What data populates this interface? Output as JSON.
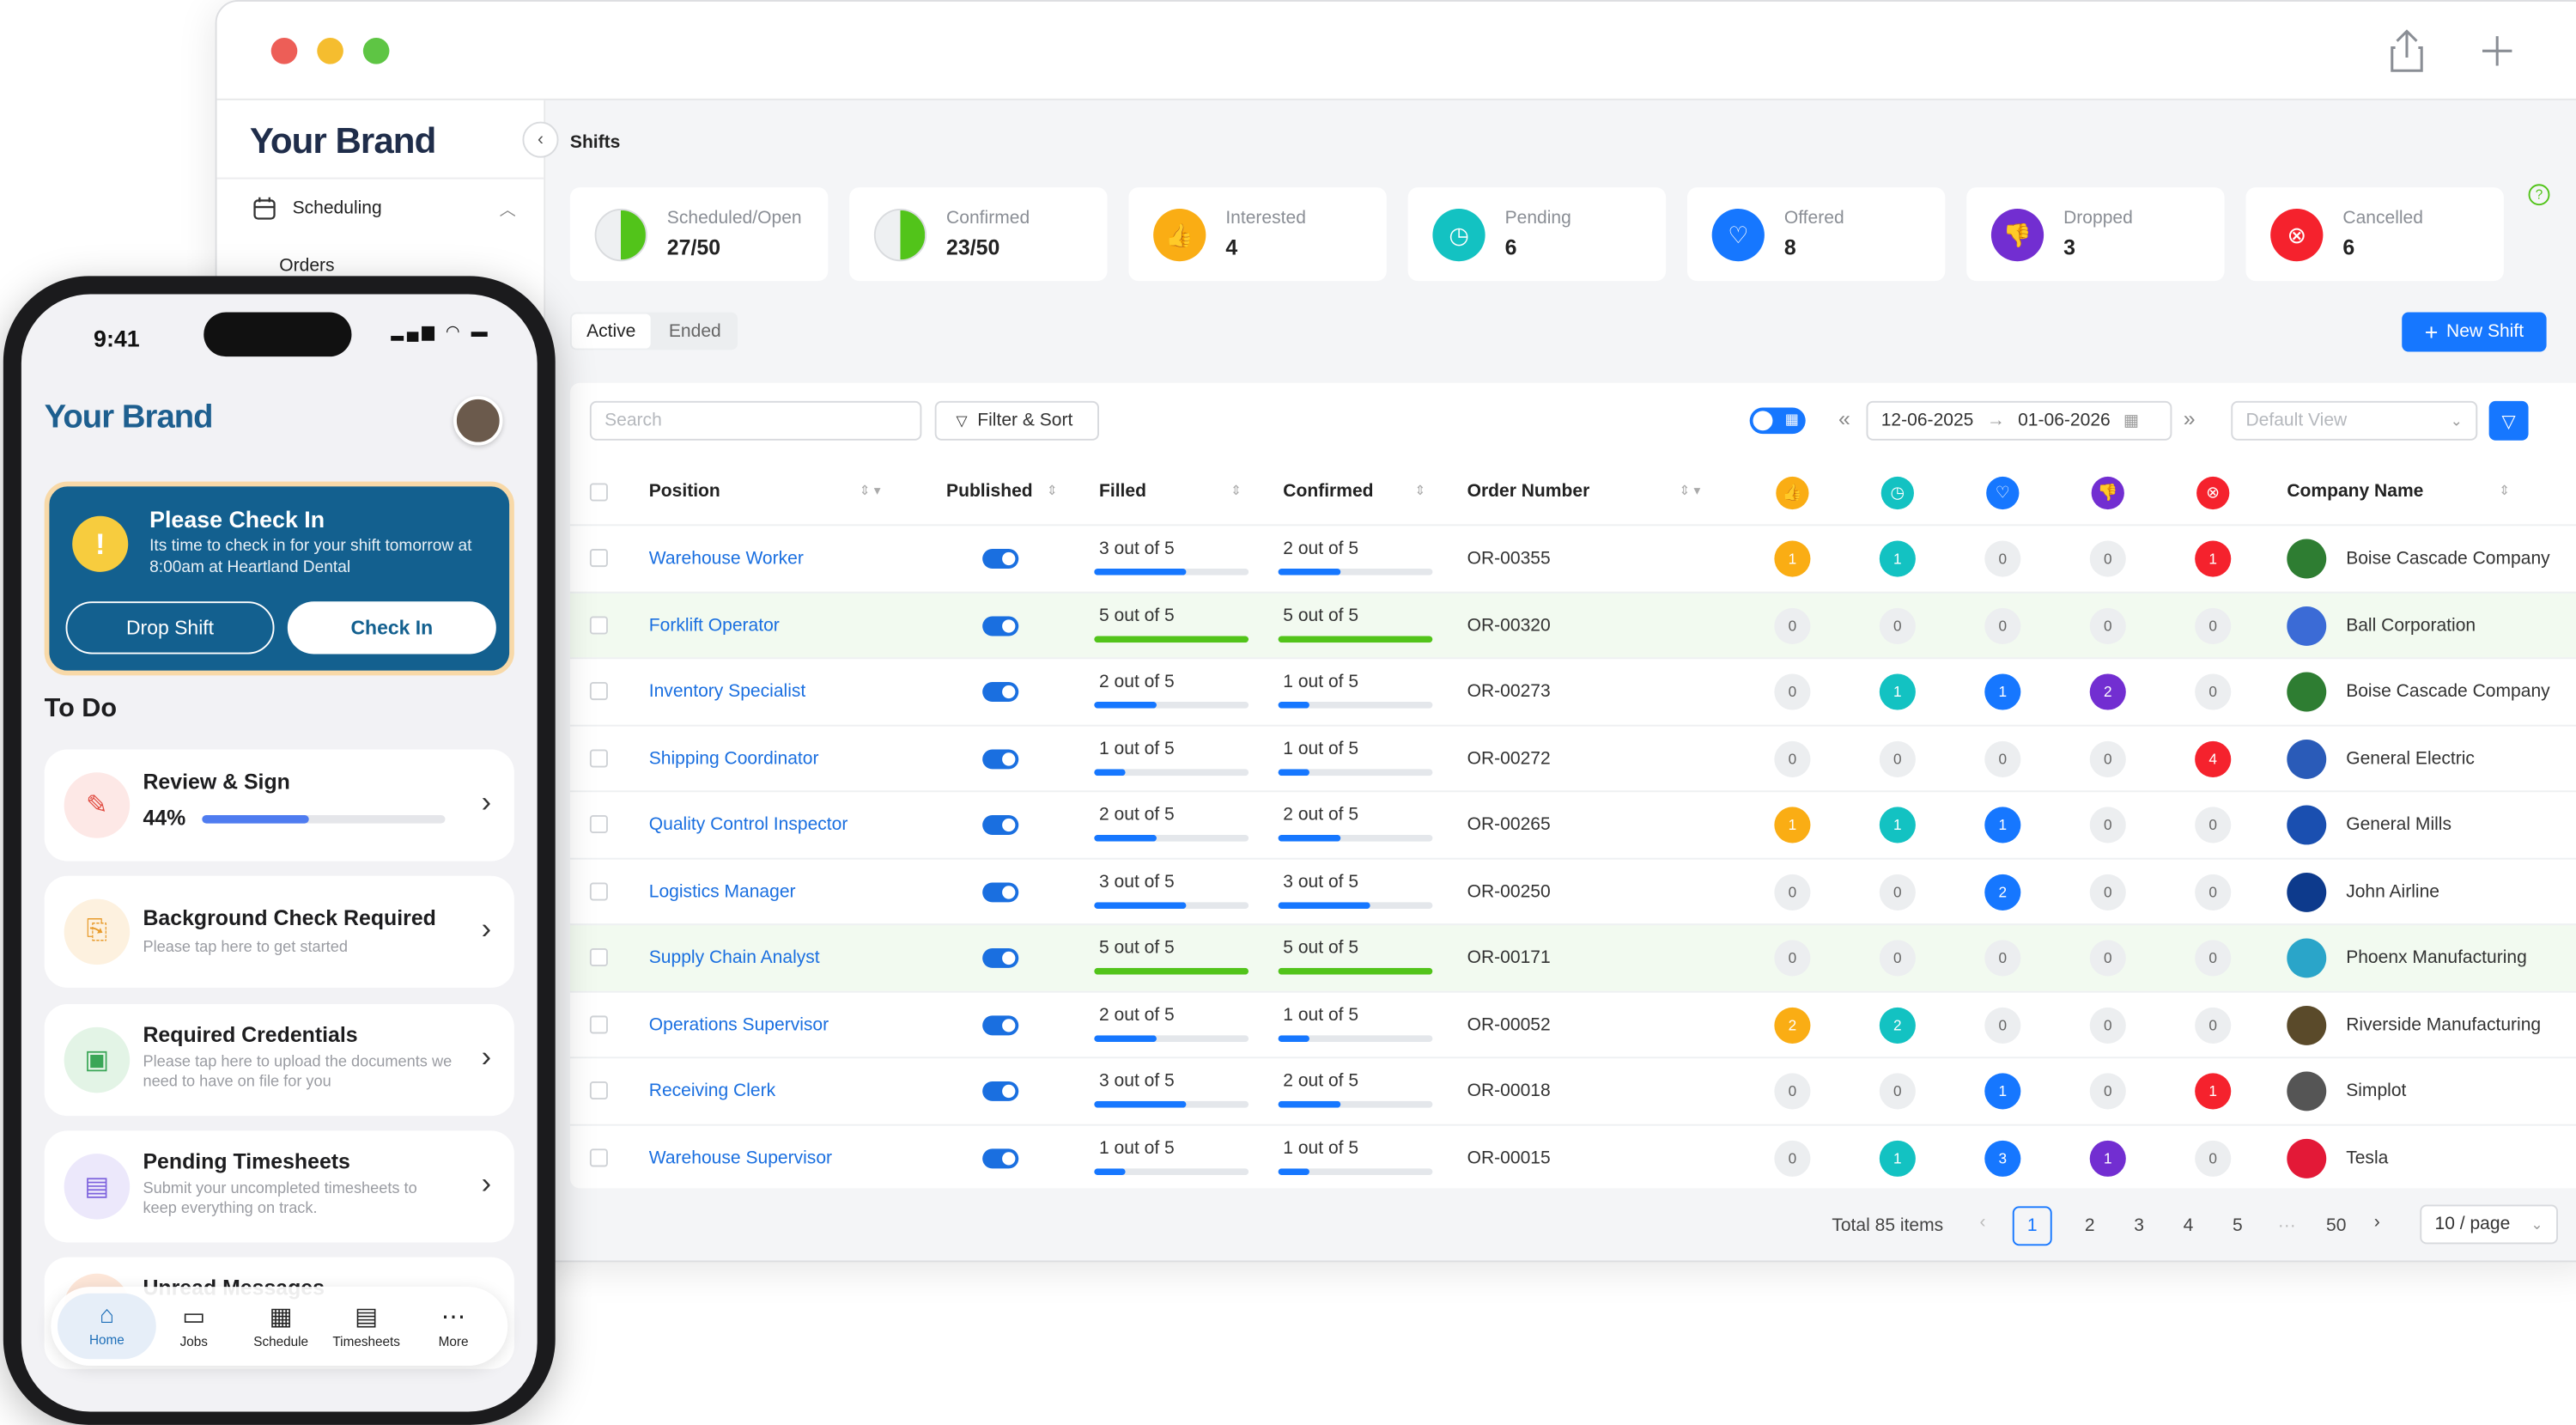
{
  "window": {
    "share_icon": "share-icon",
    "plus_icon": "plus-icon"
  },
  "sidebar": {
    "brand": "Your Brand",
    "items": [
      {
        "label": "Scheduling",
        "icon": "calendar-icon"
      },
      {
        "label": "Orders"
      }
    ]
  },
  "header": {
    "title": "Shifts"
  },
  "stats": [
    {
      "label": "Scheduled/Open",
      "value": "27/50",
      "icon": "half-pie-icon",
      "color": "#52c41a"
    },
    {
      "label": "Confirmed",
      "value": "23/50",
      "icon": "half-pie-icon",
      "color": "#52c41a"
    },
    {
      "label": "Interested",
      "value": "4",
      "icon": "thumbs-up-icon",
      "color": "#faad14"
    },
    {
      "label": "Pending",
      "value": "6",
      "icon": "clock-icon",
      "color": "#13c2c2"
    },
    {
      "label": "Offered",
      "value": "8",
      "icon": "heart-hand-icon",
      "color": "#1677ff"
    },
    {
      "label": "Dropped",
      "value": "3",
      "icon": "thumbs-down-icon",
      "color": "#722ed1"
    },
    {
      "label": "Cancelled",
      "value": "6",
      "icon": "x-circle-icon",
      "color": "#f5222d"
    }
  ],
  "tabs": {
    "active": "Active",
    "ended": "Ended"
  },
  "new_shift": "New Shift",
  "toolbar": {
    "search_placeholder": "Search",
    "filter_sort": "Filter & Sort",
    "date_from": "12-06-2025",
    "date_to": "01-06-2026",
    "view_placeholder": "Default View"
  },
  "columns": {
    "position": "Position",
    "published": "Published",
    "filled": "Filled",
    "confirmed": "Confirmed",
    "order_number": "Order Number",
    "company": "Company Name"
  },
  "rows": [
    {
      "position": "Warehouse Worker",
      "filled": "3 out of 5",
      "filled_frac": 0.6,
      "confirmed": "2 out of 5",
      "confirmed_frac": 0.4,
      "order": "OR-00355",
      "counts": [
        1,
        1,
        0,
        0,
        1
      ],
      "company": "Boise Cascade Company",
      "logo": "tree-logo",
      "logo_color": "#2e7d32"
    },
    {
      "position": "Forklift Operator",
      "filled": "5 out of 5",
      "filled_frac": 1,
      "confirmed": "5 out of 5",
      "confirmed_frac": 1,
      "order": "OR-00320",
      "counts": [
        0,
        0,
        0,
        0,
        0
      ],
      "company": "Ball Corporation",
      "logo": "ball-logo",
      "logo_color": "#3b6bd6"
    },
    {
      "position": "Inventory Specialist",
      "filled": "2 out of 5",
      "filled_frac": 0.4,
      "confirmed": "1 out of 5",
      "confirmed_frac": 0.2,
      "order": "OR-00273",
      "counts": [
        0,
        1,
        1,
        2,
        0
      ],
      "company": "Boise Cascade Company",
      "logo": "tree-logo",
      "logo_color": "#2e7d32"
    },
    {
      "position": "Shipping Coordinator",
      "filled": "1 out of 5",
      "filled_frac": 0.2,
      "confirmed": "1 out of 5",
      "confirmed_frac": 0.2,
      "order": "OR-00272",
      "counts": [
        0,
        0,
        0,
        0,
        4
      ],
      "company": "General Electric",
      "logo": "ge-logo",
      "logo_color": "#2a5bb8"
    },
    {
      "position": "Quality Control Inspector",
      "filled": "2 out of 5",
      "filled_frac": 0.4,
      "confirmed": "2 out of 5",
      "confirmed_frac": 0.4,
      "order": "OR-00265",
      "counts": [
        1,
        1,
        1,
        0,
        0
      ],
      "company": "General Mills",
      "logo": "gm-logo",
      "logo_color": "#1a4fb0"
    },
    {
      "position": "Logistics Manager",
      "filled": "3 out of 5",
      "filled_frac": 0.6,
      "confirmed": "3 out of 5",
      "confirmed_frac": 0.6,
      "order": "OR-00250",
      "counts": [
        0,
        0,
        2,
        0,
        0
      ],
      "company": "John Airline",
      "logo": "airline-logo",
      "logo_color": "#0d3a8c"
    },
    {
      "position": "Supply Chain Analyst",
      "filled": "5 out of 5",
      "filled_frac": 1,
      "confirmed": "5 out of 5",
      "confirmed_frac": 1,
      "order": "OR-00171",
      "counts": [
        0,
        0,
        0,
        0,
        0
      ],
      "company": "Phoenx Manufacturing",
      "logo": "phoenix-logo",
      "logo_color": "#2aa5c9"
    },
    {
      "position": "Operations Supervisor",
      "filled": "2 out of 5",
      "filled_frac": 0.4,
      "confirmed": "1 out of 5",
      "confirmed_frac": 0.2,
      "order": "OR-00052",
      "counts": [
        2,
        2,
        0,
        0,
        0
      ],
      "company": "Riverside Manufacturing",
      "logo": "riverside-logo",
      "logo_color": "#5a4a2a"
    },
    {
      "position": "Receiving Clerk",
      "filled": "3 out of 5",
      "filled_frac": 0.6,
      "confirmed": "2 out of 5",
      "confirmed_frac": 0.4,
      "order": "OR-00018",
      "counts": [
        0,
        0,
        1,
        0,
        1
      ],
      "company": "Simplot",
      "logo": "simplot-logo",
      "logo_color": "#555555"
    },
    {
      "position": "Warehouse Supervisor",
      "filled": "1 out of 5",
      "filled_frac": 0.2,
      "confirmed": "1 out of 5",
      "confirmed_frac": 0.2,
      "order": "OR-00015",
      "counts": [
        0,
        1,
        3,
        1,
        0
      ],
      "company": "Tesla",
      "logo": "tesla-logo",
      "logo_color": "#e31937"
    }
  ],
  "status_colors": [
    "#faad14",
    "#13c2c2",
    "#1677ff",
    "#722ed1",
    "#f5222d"
  ],
  "pagination": {
    "total": "Total 85 items",
    "pages": [
      "1",
      "2",
      "3",
      "4",
      "5",
      "···",
      "50"
    ],
    "current": "1",
    "page_size": "10 / page"
  },
  "phone": {
    "time": "9:41",
    "brand": "Your Brand",
    "checkin": {
      "title": "Please Check In",
      "text": "Its time to check in for your shift tomorrow at 8:00am at Heartland Dental",
      "drop": "Drop Shift",
      "check": "Check In"
    },
    "todo_title": "To Do",
    "todos": [
      {
        "title": "Review & Sign",
        "percent": "44%",
        "progress": 0.44
      },
      {
        "title": "Background Check Required",
        "sub": "Please tap here to get started"
      },
      {
        "title": "Required Credentials",
        "sub": "Please tap here to upload the documents we need to have on file for you"
      },
      {
        "title": "Pending Timesheets",
        "sub": "Submit your uncompleted timesheets to keep everything on track."
      },
      {
        "title": "Unread Messages"
      }
    ],
    "nav": [
      "Home",
      "Jobs",
      "Schedule",
      "Timesheets",
      "More"
    ]
  }
}
